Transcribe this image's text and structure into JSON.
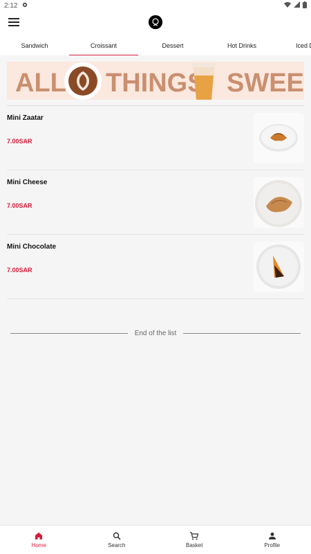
{
  "status": {
    "time": "2:12"
  },
  "tabs": [
    {
      "label": "Sandwich"
    },
    {
      "label": "Croissant"
    },
    {
      "label": "Dessert"
    },
    {
      "label": "Hot Drinks"
    },
    {
      "label": "Iced D"
    }
  ],
  "banner": {
    "word1": "ALL",
    "word2": "THINGS",
    "word3": "SWEET"
  },
  "items": [
    {
      "name": "Mini Zaatar",
      "price": "7.00SAR"
    },
    {
      "name": "Mini Cheese",
      "price": "7.00SAR"
    },
    {
      "name": "Mini Chocolate",
      "price": "7.00SAR"
    }
  ],
  "end_text": "End of the list",
  "nav": [
    {
      "label": "Home"
    },
    {
      "label": "Search"
    },
    {
      "label": "Basket"
    },
    {
      "label": "Profile"
    }
  ],
  "colors": {
    "accent": "#d81b3c",
    "banner_text": "#c98f6f",
    "banner_bg": "#fbe8df"
  }
}
